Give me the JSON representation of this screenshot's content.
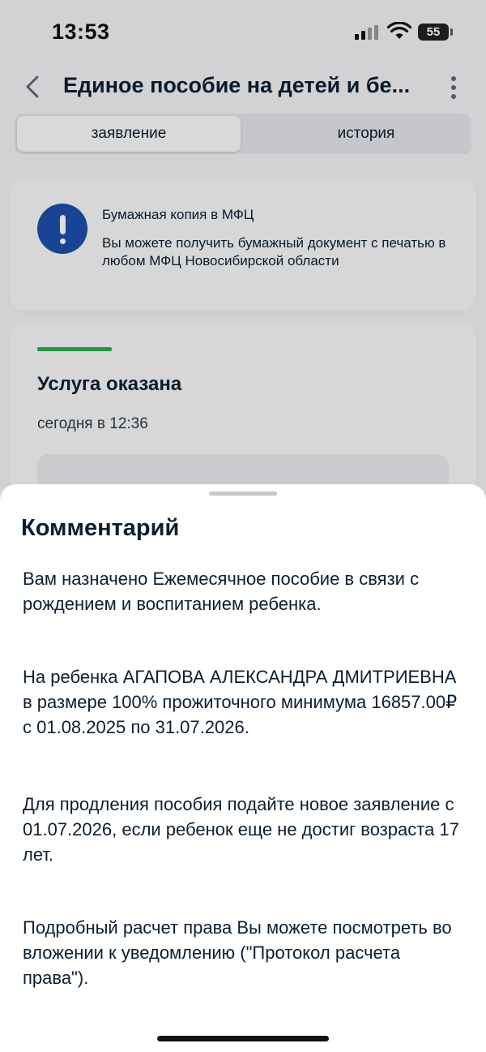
{
  "status_bar": {
    "time": "13:53",
    "battery": "55"
  },
  "header": {
    "title": "Единое пособие на детей и бе...",
    "back_icon": "chevron-left-icon",
    "menu_icon": "more-vertical-icon"
  },
  "tabs": [
    {
      "label": "заявление",
      "active": true
    },
    {
      "label": "история",
      "active": false
    }
  ],
  "info_card": {
    "icon": "exclamation-icon",
    "title": "Бумажная копия в МФЦ",
    "text": "Вы можете получить бумажный документ с печатью в любом МФЦ Новосибирской области"
  },
  "status_card": {
    "title": "Услуга оказана",
    "date": "сегодня в 12:36",
    "accent_color": "#1fb24a"
  },
  "sheet": {
    "title": "Комментарий",
    "paragraphs": [
      "Вам назначено Ежемесячное пособие в связи с рождением и воспитанием ребенка.",
      "На ребенка АГАПОВА АЛЕКСАНДРА ДМИТРИЕВНА в размере 100% прожиточного минимума 16857.00₽ с 01.08.2025 по 31.07.2026.",
      "Для продления пособия подайте новое заявление с 01.07.2026, если ребенок еще не достиг возраста 17 лет.",
      "Подробный расчет права Вы можете посмотреть во вложении к уведомлению (\"Протокол расчета права\")."
    ]
  }
}
